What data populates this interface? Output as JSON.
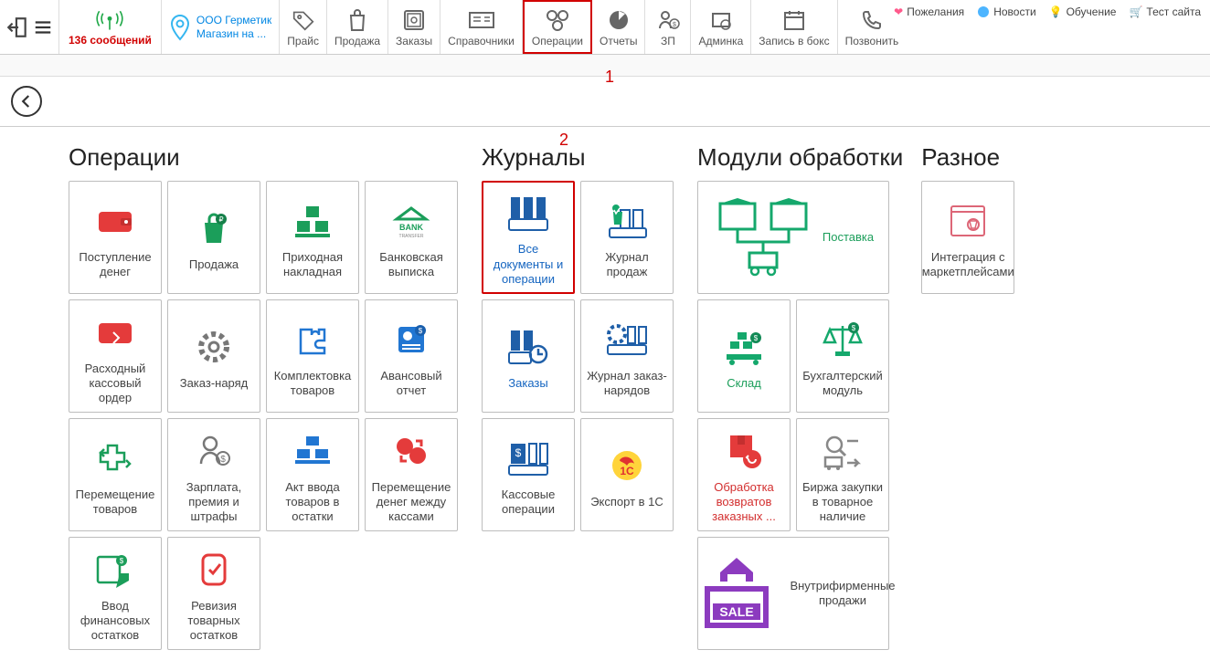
{
  "toolbar": {
    "messages": "136 сообщений",
    "location_line1": "ООО Герметик",
    "location_line2": "Магазин на ...",
    "items": [
      {
        "label": "Прайс",
        "icon": "price-tag"
      },
      {
        "label": "Продажа",
        "icon": "shopping-bag"
      },
      {
        "label": "Заказы",
        "icon": "safe"
      },
      {
        "label": "Справочники",
        "icon": "book"
      },
      {
        "label": "Операции",
        "icon": "gears",
        "selected": true
      },
      {
        "label": "Отчеты",
        "icon": "pie"
      },
      {
        "label": "ЗП",
        "icon": "salary"
      },
      {
        "label": "Админка",
        "icon": "admin"
      },
      {
        "label": "Запись в бокс",
        "icon": "calendar"
      },
      {
        "label": "Позвонить",
        "icon": "phone"
      }
    ],
    "links": [
      {
        "label": "Пожелания",
        "icon": "heart",
        "color": "#ff5a8c"
      },
      {
        "label": "Новости",
        "icon": "news",
        "color": "#4db5ff"
      },
      {
        "label": "Обучение",
        "icon": "bulb",
        "color": "#ffc107"
      },
      {
        "label": "Тест сайта",
        "icon": "cart",
        "color": "#ff9800"
      }
    ]
  },
  "annotations": {
    "a1": "1",
    "a2": "2"
  },
  "sections": {
    "operations": {
      "title": "Операции",
      "tiles": [
        {
          "label": "Поступление денег",
          "icon": "wallet-red"
        },
        {
          "label": "Продажа",
          "icon": "bag-green"
        },
        {
          "label": "Приходная накладная",
          "icon": "boxes-green"
        },
        {
          "label": "Банковская выписка",
          "icon": "bank-transfer"
        },
        {
          "label": "Расходный кассовый ордер",
          "icon": "rko"
        },
        {
          "label": "Заказ-наряд",
          "icon": "gear-gray"
        },
        {
          "label": "Комплектовка товаров",
          "icon": "puzzle-blue"
        },
        {
          "label": "Авансовый отчет",
          "icon": "advance-report"
        },
        {
          "label": "Перемещение товаров",
          "icon": "move-goods"
        },
        {
          "label": "Зарплата, премия и штрафы",
          "icon": "salary-gray"
        },
        {
          "label": "Акт ввода товаров в остатки",
          "icon": "act-blue"
        },
        {
          "label": "Перемещение денег между кассами",
          "icon": "money-swap"
        },
        {
          "label": "Ввод финансовых остатков",
          "icon": "fin-green"
        },
        {
          "label": "Ревизия товарных остатков",
          "icon": "revision-red"
        }
      ]
    },
    "journals": {
      "title": "Журналы",
      "tiles": [
        {
          "label": "Все документы и операции",
          "icon": "all-docs-blue",
          "selected": true,
          "labelClass": "blue"
        },
        {
          "label": "Журнал продаж",
          "icon": "sales-journal"
        },
        {
          "label": "Заказы",
          "icon": "orders-blue",
          "labelClass": "blue"
        },
        {
          "label": "Журнал заказ-нарядов",
          "icon": "work-order-journal"
        },
        {
          "label": "Кассовые операции",
          "icon": "cash-ops"
        },
        {
          "label": "Экспорт в 1С",
          "icon": "export-1c"
        }
      ]
    },
    "modules": {
      "title": "Модули обработки",
      "tiles": [
        {
          "label": "Поставка",
          "icon": "supply-green",
          "wide": true,
          "labelClass": "green"
        },
        {
          "label": "Склад",
          "icon": "warehouse-green",
          "labelClass": "green"
        },
        {
          "label": "Бухгалтерский модуль",
          "icon": "scales-green"
        },
        {
          "label": "Обработка возвратов заказных ...",
          "icon": "returns-red",
          "labelClass": "red"
        },
        {
          "label": "Биржа закупки в товарное наличие",
          "icon": "exchange-gray"
        },
        {
          "label": "Внутрифирменные продажи",
          "icon": "sale-purple",
          "wide": true
        }
      ]
    },
    "misc": {
      "title": "Разное",
      "tiles": [
        {
          "label": "Интеграция с маркетплейсами",
          "icon": "marketplace"
        }
      ]
    }
  }
}
